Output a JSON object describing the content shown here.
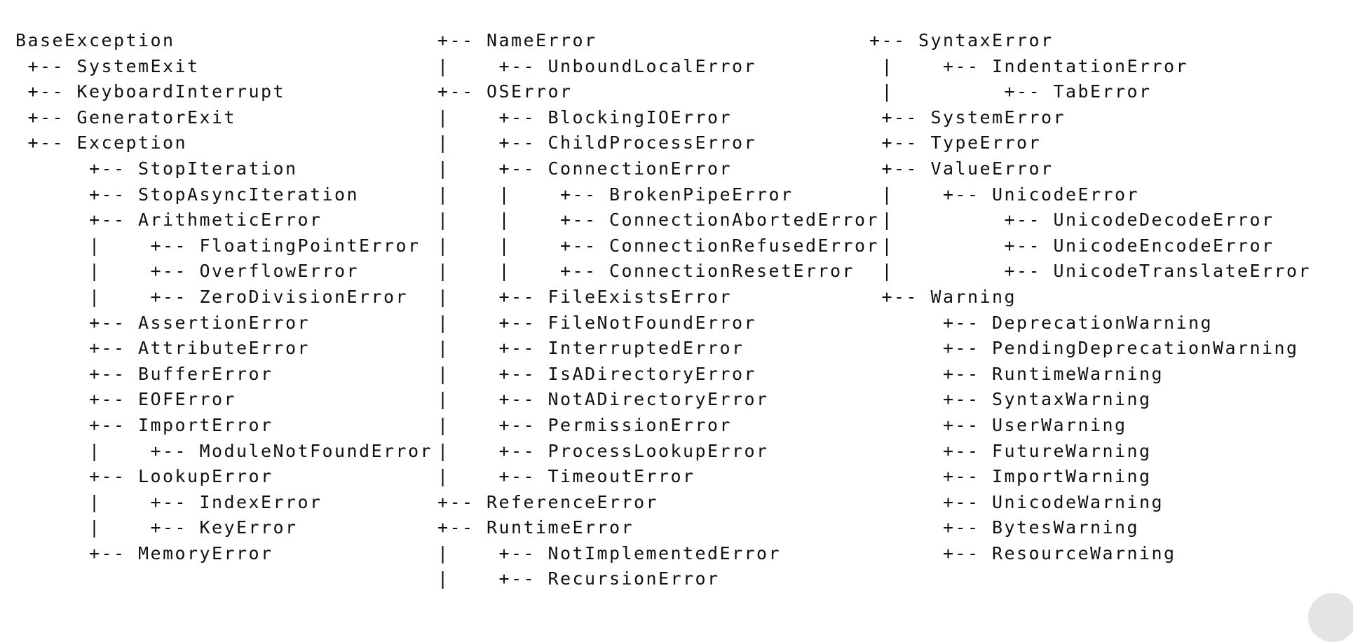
{
  "columns": [
    {
      "lines": [
        "BaseException",
        " +-- SystemExit",
        " +-- KeyboardInterrupt",
        " +-- GeneratorExit",
        " +-- Exception",
        "      +-- StopIteration",
        "      +-- StopAsyncIteration",
        "      +-- ArithmeticError",
        "      |    +-- FloatingPointError",
        "      |    +-- OverflowError",
        "      |    +-- ZeroDivisionError",
        "      +-- AssertionError",
        "      +-- AttributeError",
        "      +-- BufferError",
        "      +-- EOFError",
        "      +-- ImportError",
        "      |    +-- ModuleNotFoundError",
        "      +-- LookupError",
        "      |    +-- IndexError",
        "      |    +-- KeyError",
        "      +-- MemoryError"
      ]
    },
    {
      "lines": [
        "+-- NameError",
        "|    +-- UnboundLocalError",
        "+-- OSError",
        "|    +-- BlockingIOError",
        "|    +-- ChildProcessError",
        "|    +-- ConnectionError",
        "|    |    +-- BrokenPipeError",
        "|    |    +-- ConnectionAbortedError",
        "|    |    +-- ConnectionRefusedError",
        "|    |    +-- ConnectionResetError",
        "|    +-- FileExistsError",
        "|    +-- FileNotFoundError",
        "|    +-- InterruptedError",
        "|    +-- IsADirectoryError",
        "|    +-- NotADirectoryError",
        "|    +-- PermissionError",
        "|    +-- ProcessLookupError",
        "|    +-- TimeoutError",
        "+-- ReferenceError",
        "+-- RuntimeError",
        "|    +-- NotImplementedError",
        "|    +-- RecursionError"
      ]
    },
    {
      "lines": [
        "+-- SyntaxError",
        " |    +-- IndentationError",
        " |         +-- TabError",
        " +-- SystemError",
        " +-- TypeError",
        " +-- ValueError",
        " |    +-- UnicodeError",
        " |         +-- UnicodeDecodeError",
        " |         +-- UnicodeEncodeError",
        " |         +-- UnicodeTranslateError",
        " +-- Warning",
        "      +-- DeprecationWarning",
        "      +-- PendingDeprecationWarning",
        "      +-- RuntimeWarning",
        "      +-- SyntaxWarning",
        "      +-- UserWarning",
        "      +-- FutureWarning",
        "      +-- ImportWarning",
        "      +-- UnicodeWarning",
        "      +-- BytesWarning",
        "      +-- ResourceWarning"
      ]
    }
  ]
}
